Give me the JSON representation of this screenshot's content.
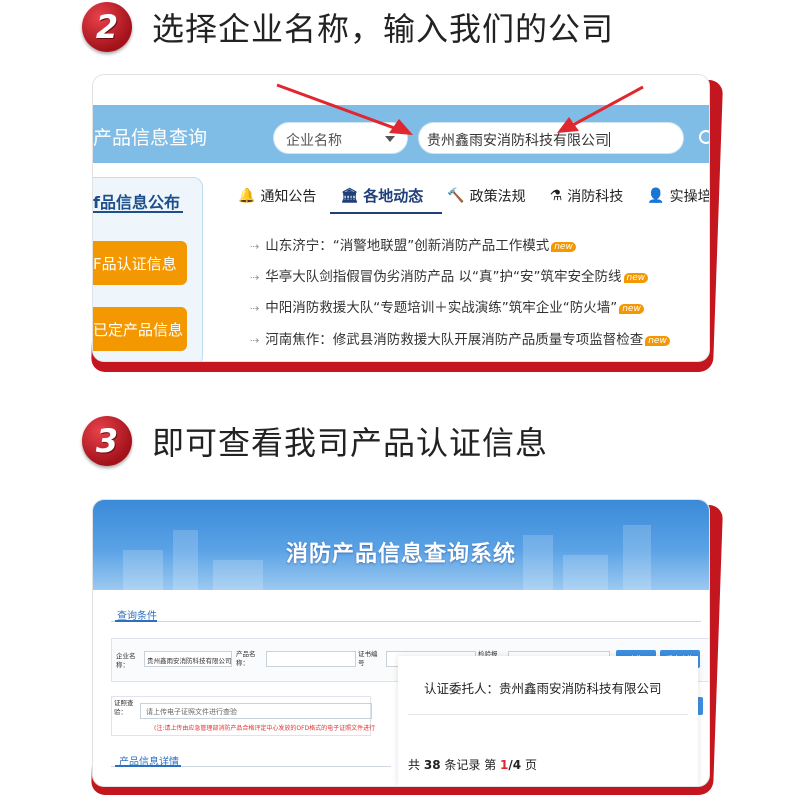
{
  "step2": {
    "number": "2",
    "title": "选择企业名称，输入我们的公司"
  },
  "step3": {
    "number": "3",
    "title": "即可查看我司产品认证信息"
  },
  "panel1": {
    "site_title": "产品信息查询",
    "select_value": "企业名称",
    "search_value": "贵州鑫雨安消防科技有限公司",
    "side_title": "f品信息公布",
    "side_buttons": [
      "F品认证信息",
      "已定产品信息"
    ],
    "tabs": [
      {
        "icon": "🔔",
        "label": "通知公告"
      },
      {
        "icon": "🏛",
        "label": "各地动态"
      },
      {
        "icon": "🔨",
        "label": "政策法规"
      },
      {
        "icon": "⚗",
        "label": "消防科技"
      },
      {
        "icon": "👤",
        "label": "实操培"
      }
    ],
    "news": [
      "山东济宁：“消警地联盟”创新消防产品工作模式",
      "华亭大队剑指假冒伪劣消防产品 以“真”护“安”筑牢安全防线",
      "中阳消防救援大队“专题培训＋实战演练”筑牢企业“防火墙”",
      "河南焦作：修武县消防救援大队开展消防产品质量专项监督检查"
    ],
    "new_badge": "new"
  },
  "panel2": {
    "banner_title": "消防产品信息查询系统",
    "query_section": "查询条件",
    "labels": {
      "company": "企业名称：",
      "product": "产品名称：",
      "cert_no": "证书编号",
      "report": "检验报告",
      "ecert": "证照查验："
    },
    "company_value": "贵州鑫雨安消防科技有限公司",
    "query_button": "查询",
    "combined_button": "组合查询",
    "upload_placeholder": "请上传电子证照文件进行查验",
    "upload_hint": "(注:请上传由应急管理部消防产品合格评定中心发放的OFD格式的电子证照文件进行",
    "upload_button": "验",
    "detail_section": "产品信息详情",
    "popup_label": "认证委托人：",
    "popup_value": "贵州鑫雨安消防科技有限公司",
    "pager_prefix": "共",
    "pager_total": "38",
    "pager_mid": "条记录  第",
    "pager_current": "1",
    "pager_sep": "/4",
    "pager_suffix": "页"
  }
}
